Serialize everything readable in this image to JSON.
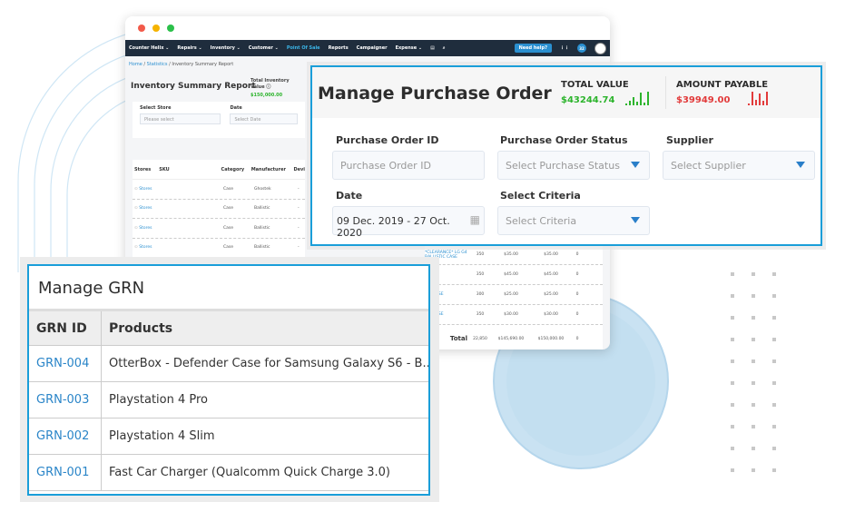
{
  "colors": {
    "accent": "#1a9ed9",
    "nav": "#1f2d3d",
    "green": "#2db42d",
    "red": "#e23b3b"
  },
  "window": {
    "nav": [
      {
        "label": "Counter Helix ⌄"
      },
      {
        "label": "Repairs ⌄"
      },
      {
        "label": "Inventory ⌄"
      },
      {
        "label": "Customer ⌄"
      },
      {
        "label": "Point Of Sale",
        "active": true
      },
      {
        "label": "Reports"
      },
      {
        "label": "Campaigner"
      },
      {
        "label": "Expense ⌄"
      }
    ],
    "help": "Need help?",
    "badge": "32",
    "breadcrumb": [
      "Home",
      "Statistics",
      "Inventory Summary Report"
    ],
    "title": "Inventory Summary Report",
    "total_label": "Total Inventory Value ⓘ",
    "total_value": "$150,000.00",
    "filters": {
      "store_label": "Select Store",
      "store_placeholder": "Please select",
      "date_label": "Date",
      "date_placeholder": "Select Date"
    },
    "columns": [
      "Stores",
      "SKU",
      "Category",
      "Manufacturer",
      "Devi"
    ],
    "rows": [
      [
        "Stores",
        "",
        "Case",
        "Ghostek",
        "-"
      ],
      [
        "Stores",
        "",
        "Case",
        "Ballistic",
        "-"
      ],
      [
        "Stores",
        "",
        "Case",
        "Ballistic",
        "-"
      ],
      [
        "Stores",
        "",
        "Case",
        "Ballistic",
        "-"
      ]
    ],
    "right_rows": [
      [
        "*CLEARANCE* LG G4 BALLISTIC CASE",
        "350",
        "$35.00",
        "$35.00",
        "0"
      ],
      [
        "",
        "350",
        "$45.00",
        "$45.00",
        "0"
      ],
      [
        "TIC CASE",
        "300",
        "$25.00",
        "$25.00",
        "0"
      ],
      [
        "TIC CASE",
        "350",
        "$30.00",
        "$30.00",
        "0"
      ]
    ],
    "total_row": {
      "label": "Total",
      "qty": "22,850",
      "cost": "$145,690.00",
      "value": "$150,000.00",
      "other": "0"
    }
  },
  "po": {
    "title": "Manage Purchase Order",
    "total_value_label": "TOTAL VALUE",
    "total_value": "$43244.74",
    "payable_label": "AMOUNT PAYABLE",
    "payable": "$39949.00",
    "fields": {
      "id_label": "Purchase Order ID",
      "id_placeholder": "Purchase Order ID",
      "status_label": "Purchase Order Status",
      "status_placeholder": "Select Purchase Status",
      "supplier_label": "Supplier",
      "supplier_placeholder": "Select Supplier",
      "date_label": "Date",
      "date_value": "09 Dec. 2019 - 27 Oct. 2020",
      "criteria_label": "Select Criteria",
      "criteria_placeholder": "Select Criteria"
    }
  },
  "grn": {
    "title": "Manage GRN",
    "columns": [
      "GRN ID",
      "Products"
    ],
    "rows": [
      [
        "GRN-004",
        "OtterBox - Defender Case for Samsung Galaxy S6 - B..."
      ],
      [
        "GRN-003",
        "Playstation 4 Pro"
      ],
      [
        "GRN-002",
        "Playstation 4 Slim"
      ],
      [
        "GRN-001",
        "Fast Car Charger (Qualcomm Quick Charge 3.0)"
      ]
    ]
  }
}
